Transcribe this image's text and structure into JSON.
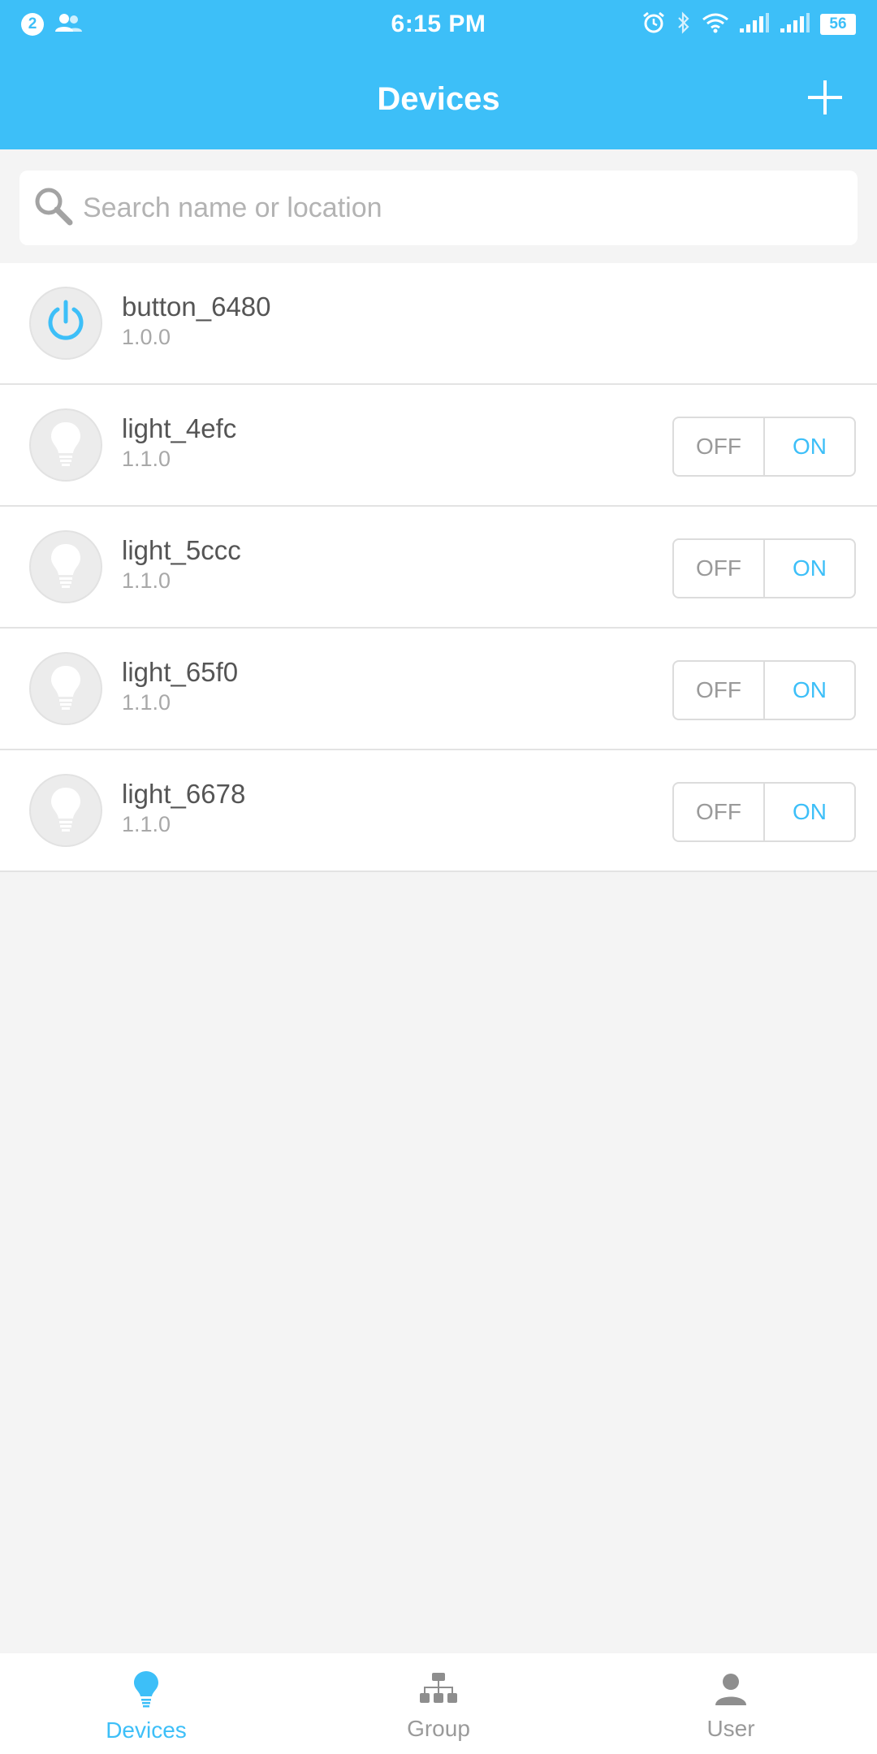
{
  "status_bar": {
    "notification_count": "2",
    "time": "6:15 PM",
    "battery": "56",
    "icons": [
      "notification-badge",
      "contacts-icon",
      "alarm-icon",
      "bluetooth-icon",
      "wifi-icon",
      "signal-icon",
      "signal-icon",
      "battery-icon"
    ]
  },
  "header": {
    "title": "Devices",
    "add_icon": "plus-icon"
  },
  "search": {
    "placeholder": "Search name or location",
    "value": ""
  },
  "devices": [
    {
      "name": "button_6480",
      "version": "1.0.0",
      "icon": "power-icon",
      "has_toggle": false
    },
    {
      "name": "light_4efc",
      "version": "1.1.0",
      "icon": "lightbulb-icon",
      "has_toggle": true,
      "off_label": "OFF",
      "on_label": "ON"
    },
    {
      "name": "light_5ccc",
      "version": "1.1.0",
      "icon": "lightbulb-icon",
      "has_toggle": true,
      "off_label": "OFF",
      "on_label": "ON"
    },
    {
      "name": "light_65f0",
      "version": "1.1.0",
      "icon": "lightbulb-icon",
      "has_toggle": true,
      "off_label": "OFF",
      "on_label": "ON"
    },
    {
      "name": "light_6678",
      "version": "1.1.0",
      "icon": "lightbulb-icon",
      "has_toggle": true,
      "off_label": "OFF",
      "on_label": "ON"
    }
  ],
  "bottom_nav": {
    "items": [
      {
        "label": "Devices",
        "icon": "lightbulb-icon",
        "active": true
      },
      {
        "label": "Group",
        "icon": "hierarchy-icon",
        "active": false
      },
      {
        "label": "User",
        "icon": "user-icon",
        "active": false
      }
    ]
  },
  "colors": {
    "accent": "#3dbff8",
    "background": "#f4f4f4",
    "inactive": "#9a9a9a"
  }
}
